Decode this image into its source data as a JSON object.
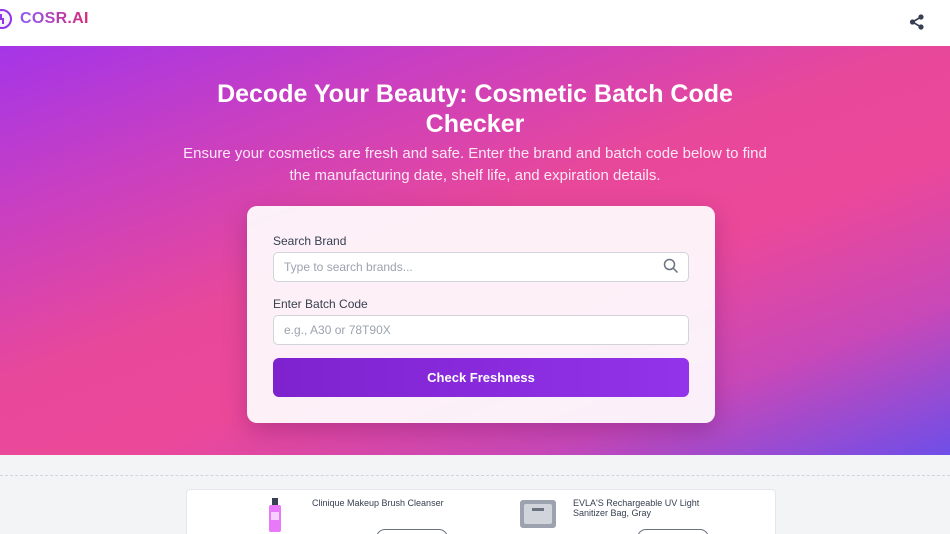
{
  "header": {
    "logo_text": "COSR.AI",
    "logo_icon": "clock-logo-icon",
    "share_icon": "share-icon"
  },
  "hero": {
    "title": "Decode Your Beauty: Cosmetic Batch Code Checker",
    "subtitle": "Ensure your cosmetics are fresh and safe. Enter the brand and batch code below to find the manufacturing date, shelf life, and expiration details."
  },
  "form": {
    "brand_label": "Search Brand",
    "brand_placeholder": "Type to search brands...",
    "brand_value": "",
    "search_icon": "magnifier-icon",
    "batch_label": "Enter Batch Code",
    "batch_placeholder": "e.g., A30 or 78T90X",
    "batch_value": "",
    "submit_label": "Check Freshness"
  },
  "products": [
    {
      "name": "Clinique Makeup Brush Cleanser",
      "image": "cleanser-bottle-image"
    },
    {
      "name": "EVLA'S Rechargeable UV Light Sanitizer Bag, Gray",
      "image": "sanitizer-bag-image"
    }
  ],
  "colors": {
    "accent": "#9333ea",
    "button": "#7e22ce",
    "hero_start": "#a435e8",
    "hero_mid": "#ec4899",
    "hero_end": "#6f4ee8"
  }
}
